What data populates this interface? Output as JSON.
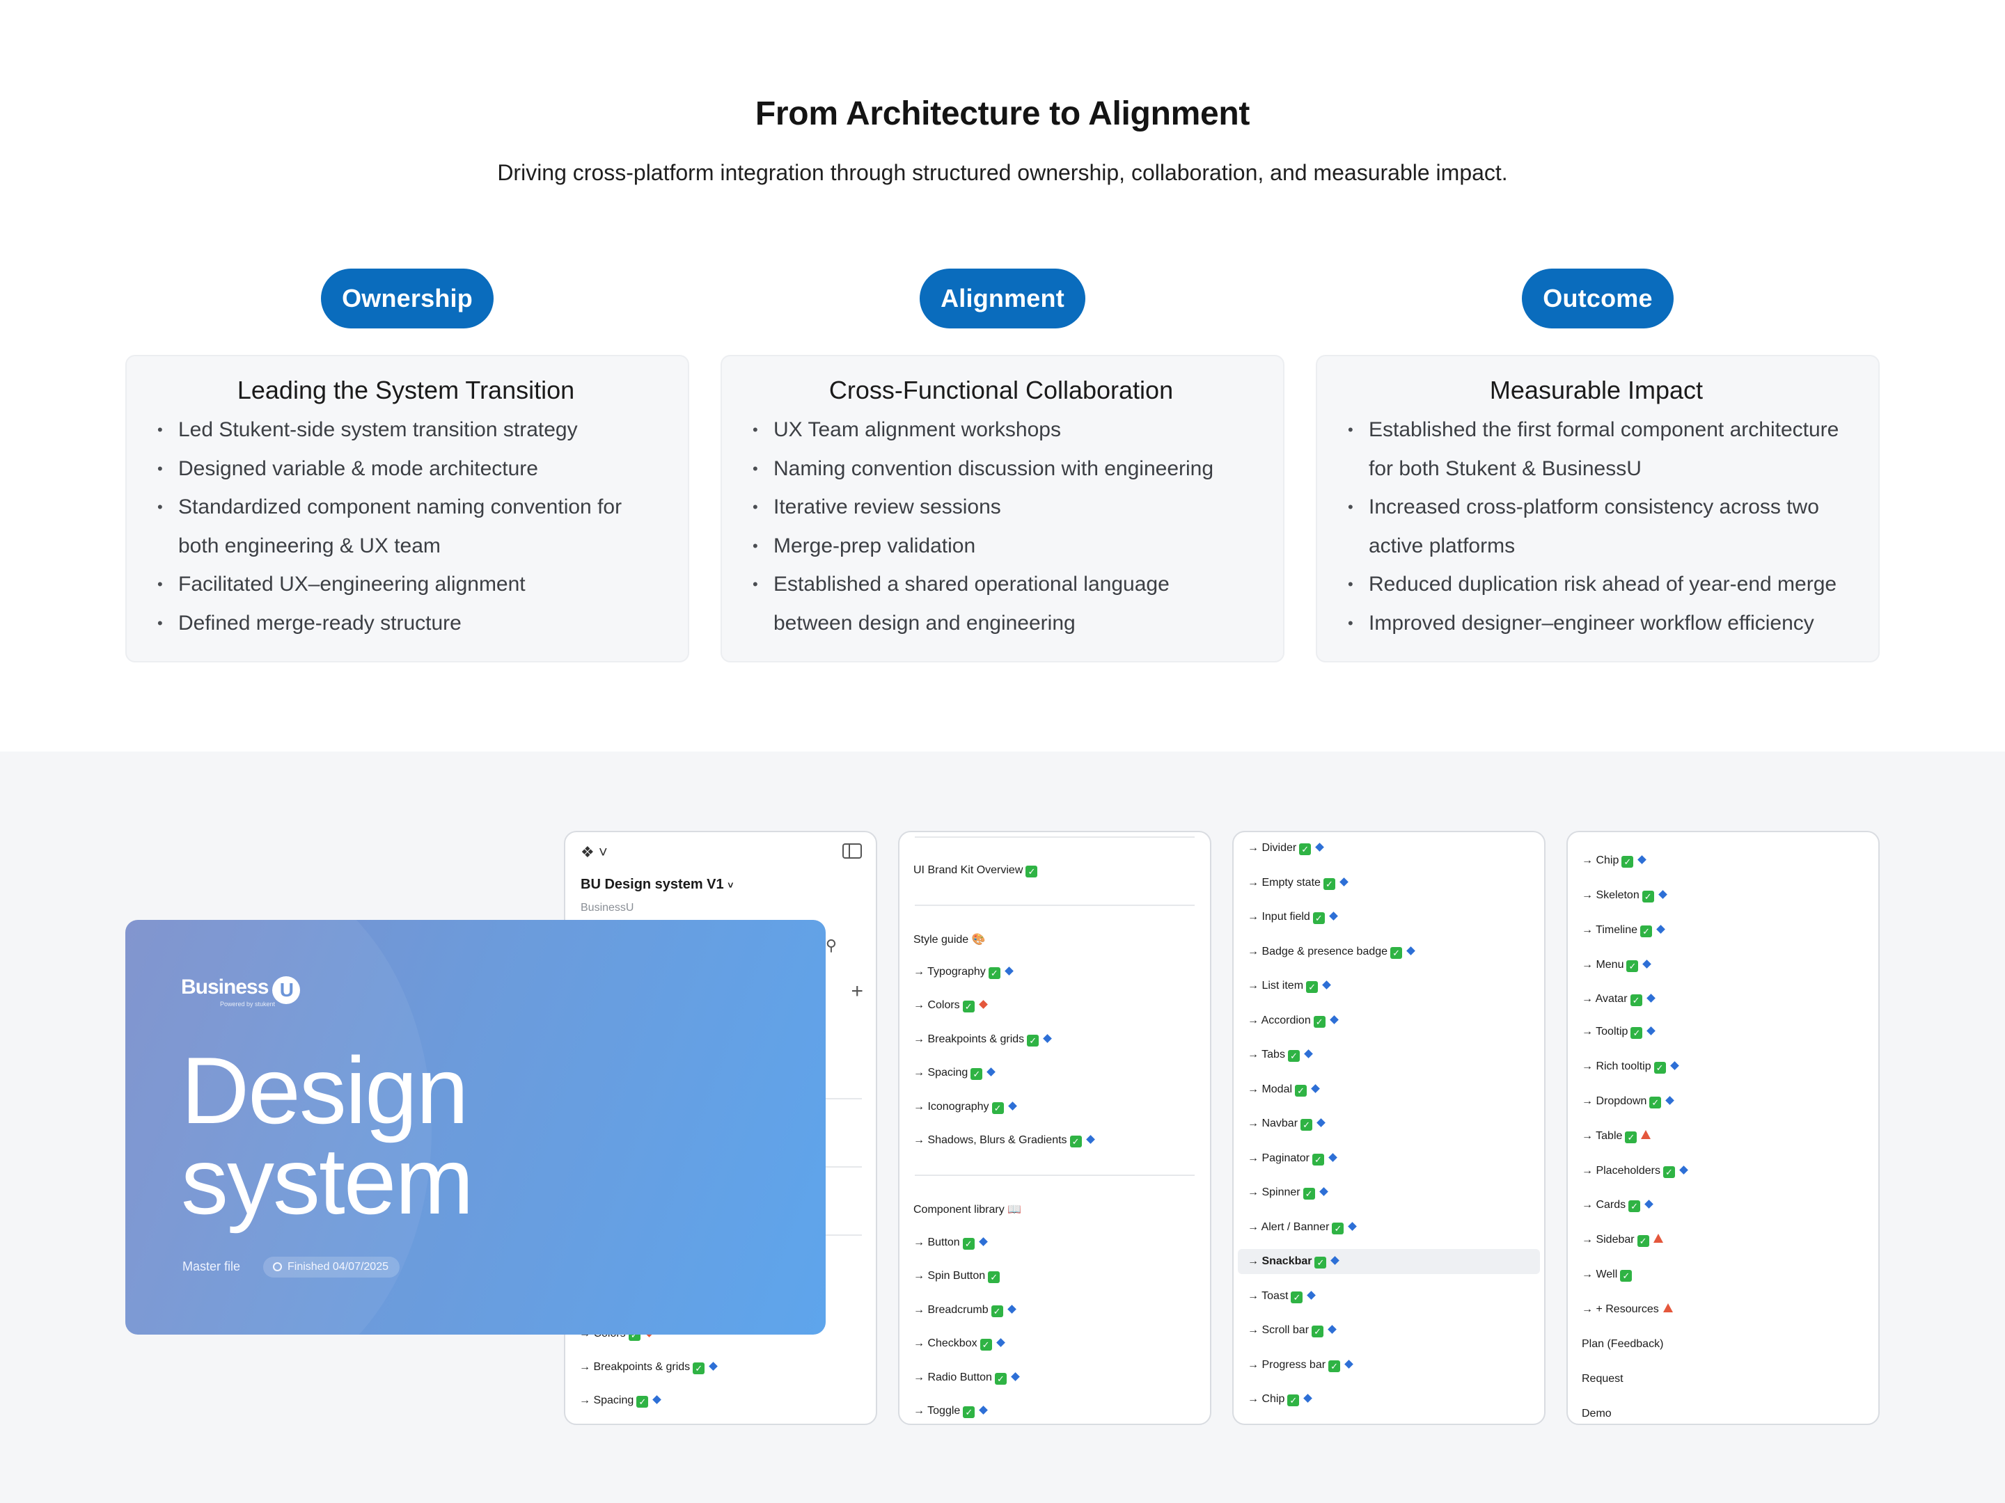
{
  "header": {
    "title": "From Architecture to Alignment",
    "subtitle": "Driving cross-platform integration through structured ownership, collaboration, and measurable impact."
  },
  "columns": [
    {
      "pill": "Ownership",
      "card_title": "Leading the System Transition",
      "items": [
        "Led Stukent-side system transition strategy",
        "Designed variable & mode architecture",
        "Standardized component naming convention for both engineering & UX team",
        "Facilitated UX–engineering alignment",
        "Defined merge-ready structure"
      ]
    },
    {
      "pill": "Alignment",
      "card_title": "Cross-Functional Collaboration",
      "items": [
        "UX Team alignment workshops",
        "Naming convention discussion with engineering",
        "Iterative review sessions",
        "Merge-prep validation",
        "Established a shared operational language between design and engineering"
      ]
    },
    {
      "pill": "Outcome",
      "card_title": "Measurable Impact",
      "items": [
        "Established the first formal component architecture for both Stukent & BusinessU",
        "Increased cross-platform consistency across two active platforms",
        "Reduced duplication risk ahead of year-end merge",
        "Improved designer–engineer workflow efficiency"
      ]
    }
  ],
  "file_panel": {
    "file_title": "BU Design system V1",
    "team": "BusinessU",
    "items": [
      {
        "label": "→ Colors"
      },
      {
        "label": "→ Breakpoints & grids"
      },
      {
        "label": "→ Spacing"
      }
    ]
  },
  "cover": {
    "brand": "Business",
    "brand_mark": "U",
    "brand_tag": "Powered by stukent",
    "heading_line1": "Design",
    "heading_line2": "system",
    "meta": "Master file",
    "badge": "Finished 04/07/2025"
  },
  "panel2": {
    "rows": [
      {
        "label": "UI Brand Kit Overview",
        "check": true
      },
      {
        "label": "Style guide 🎨"
      },
      {
        "label": "→ Typography",
        "check": true,
        "mark": "blue"
      },
      {
        "label": "→ Colors",
        "check": true,
        "mark": "orange"
      },
      {
        "label": "→ Breakpoints & grids",
        "check": true,
        "mark": "blue"
      },
      {
        "label": "→ Spacing",
        "check": true,
        "mark": "blue"
      },
      {
        "label": "→ Iconography",
        "check": true,
        "mark": "blue"
      },
      {
        "label": "→ Shadows, Blurs & Gradients",
        "check": true,
        "mark": "blue"
      },
      {
        "label": "Component library 📖"
      },
      {
        "label": "→ Button",
        "check": true,
        "mark": "blue"
      },
      {
        "label": "→ Spin Button",
        "check": true
      },
      {
        "label": "→ Breadcrumb",
        "check": true,
        "mark": "blue"
      },
      {
        "label": "→ Checkbox",
        "check": true,
        "mark": "blue"
      },
      {
        "label": "→ Radio Button",
        "check": true,
        "mark": "blue"
      },
      {
        "label": "→ Toggle",
        "check": true,
        "mark": "blue"
      }
    ]
  },
  "panel3": {
    "rows": [
      {
        "label": "→ Divider",
        "check": true,
        "mark": "blue"
      },
      {
        "label": "→ Empty state",
        "check": true,
        "mark": "blue"
      },
      {
        "label": "→ Input field",
        "check": true,
        "mark": "blue"
      },
      {
        "label": "→ Badge & presence badge",
        "check": true,
        "mark": "blue"
      },
      {
        "label": "→ List item",
        "check": true,
        "mark": "blue"
      },
      {
        "label": "→ Accordion",
        "check": true,
        "mark": "blue"
      },
      {
        "label": "→ Tabs",
        "check": true,
        "mark": "blue"
      },
      {
        "label": "→ Modal",
        "check": true,
        "mark": "blue"
      },
      {
        "label": "→ Navbar",
        "check": true,
        "mark": "blue"
      },
      {
        "label": "→ Paginator",
        "check": true,
        "mark": "blue"
      },
      {
        "label": "→ Spinner",
        "check": true,
        "mark": "blue"
      },
      {
        "label": "→ Alert / Banner",
        "check": true,
        "mark": "blue"
      },
      {
        "label": "→ Snackbar",
        "check": true,
        "mark": "blue",
        "selected": true
      },
      {
        "label": "→ Toast",
        "check": true,
        "mark": "blue"
      },
      {
        "label": "→ Scroll bar",
        "check": true,
        "mark": "blue"
      },
      {
        "label": "→ Progress bar",
        "check": true,
        "mark": "blue"
      },
      {
        "label": "→ Chip",
        "check": true,
        "mark": "blue"
      }
    ]
  },
  "panel4": {
    "rows": [
      {
        "label": "→ Chip",
        "check": true,
        "mark": "blue"
      },
      {
        "label": "→ Skeleton",
        "check": true,
        "mark": "blue"
      },
      {
        "label": "→ Timeline",
        "check": true,
        "mark": "blue"
      },
      {
        "label": "→ Menu",
        "check": true,
        "mark": "blue"
      },
      {
        "label": "→ Avatar",
        "check": true,
        "mark": "blue"
      },
      {
        "label": "→ Tooltip",
        "check": true,
        "mark": "blue"
      },
      {
        "label": "→ Rich tooltip",
        "check": true,
        "mark": "blue"
      },
      {
        "label": "→ Dropdown",
        "check": true,
        "mark": "blue"
      },
      {
        "label": "→ Table",
        "check": true,
        "mark": "warn"
      },
      {
        "label": "→ Placeholders",
        "check": true,
        "mark": "blue"
      },
      {
        "label": "→ Cards",
        "check": true,
        "mark": "blue"
      },
      {
        "label": "→ Sidebar",
        "check": true,
        "mark": "warn"
      },
      {
        "label": "→ Well",
        "check": true
      },
      {
        "label": "→ + Resources",
        "mark": "warn"
      },
      {
        "label": "Plan (Feedback)"
      },
      {
        "label": "Request"
      },
      {
        "label": "Demo"
      }
    ]
  },
  "colors": {
    "pill": "#0a6cbd",
    "check": "#2fb344",
    "diamond_blue": "#2d6fd6",
    "warn_orange": "#e4573c"
  }
}
